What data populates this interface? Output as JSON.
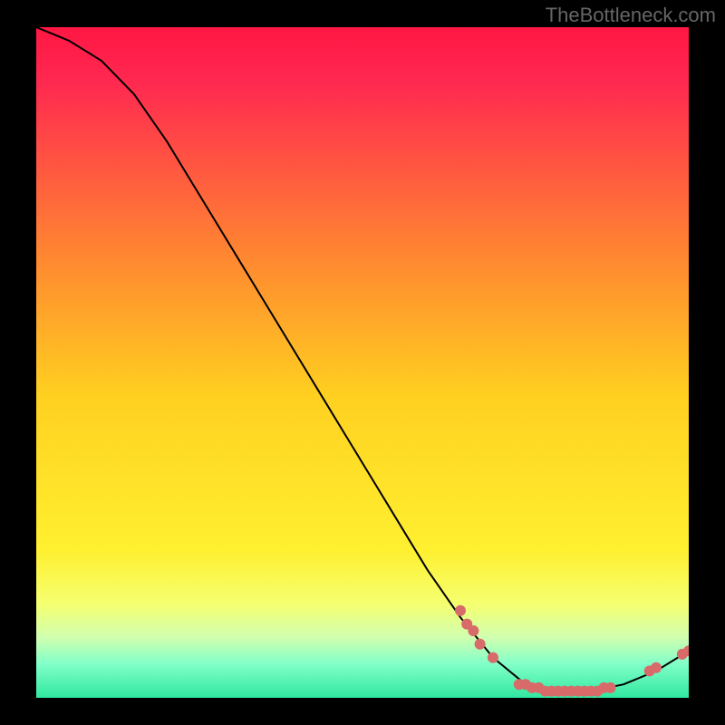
{
  "watermark": "TheBottleneck.com",
  "chart_data": {
    "type": "line",
    "title": "",
    "xlabel": "",
    "ylabel": "",
    "xlim": [
      0,
      100
    ],
    "ylim": [
      0,
      100
    ],
    "curve": [
      {
        "x": 0,
        "y": 100
      },
      {
        "x": 5,
        "y": 98
      },
      {
        "x": 10,
        "y": 95
      },
      {
        "x": 15,
        "y": 90
      },
      {
        "x": 20,
        "y": 83
      },
      {
        "x": 25,
        "y": 75
      },
      {
        "x": 30,
        "y": 67
      },
      {
        "x": 35,
        "y": 59
      },
      {
        "x": 40,
        "y": 51
      },
      {
        "x": 45,
        "y": 43
      },
      {
        "x": 50,
        "y": 35
      },
      {
        "x": 55,
        "y": 27
      },
      {
        "x": 60,
        "y": 19
      },
      {
        "x": 65,
        "y": 12
      },
      {
        "x": 70,
        "y": 6
      },
      {
        "x": 75,
        "y": 2
      },
      {
        "x": 80,
        "y": 1
      },
      {
        "x": 85,
        "y": 1
      },
      {
        "x": 90,
        "y": 2
      },
      {
        "x": 95,
        "y": 4
      },
      {
        "x": 100,
        "y": 7
      }
    ],
    "points": [
      {
        "x": 65,
        "y": 13
      },
      {
        "x": 66,
        "y": 11
      },
      {
        "x": 67,
        "y": 10
      },
      {
        "x": 68,
        "y": 8
      },
      {
        "x": 70,
        "y": 6
      },
      {
        "x": 74,
        "y": 2
      },
      {
        "x": 75,
        "y": 2
      },
      {
        "x": 76,
        "y": 1.5
      },
      {
        "x": 77,
        "y": 1.5
      },
      {
        "x": 78,
        "y": 1
      },
      {
        "x": 79,
        "y": 1
      },
      {
        "x": 80,
        "y": 1
      },
      {
        "x": 81,
        "y": 1
      },
      {
        "x": 82,
        "y": 1
      },
      {
        "x": 83,
        "y": 1
      },
      {
        "x": 84,
        "y": 1
      },
      {
        "x": 85,
        "y": 1
      },
      {
        "x": 86,
        "y": 1
      },
      {
        "x": 87,
        "y": 1.5
      },
      {
        "x": 88,
        "y": 1.5
      },
      {
        "x": 94,
        "y": 4
      },
      {
        "x": 95,
        "y": 4.5
      },
      {
        "x": 99,
        "y": 6.5
      },
      {
        "x": 100,
        "y": 7
      }
    ],
    "gradient_stops": [
      {
        "offset": 0,
        "color": "#ff1744"
      },
      {
        "offset": 0.08,
        "color": "#ff2850"
      },
      {
        "offset": 0.35,
        "color": "#ff8a30"
      },
      {
        "offset": 0.55,
        "color": "#ffd020"
      },
      {
        "offset": 0.78,
        "color": "#fff030"
      },
      {
        "offset": 0.86,
        "color": "#f5ff70"
      },
      {
        "offset": 0.91,
        "color": "#d0ffb0"
      },
      {
        "offset": 0.95,
        "color": "#80ffc8"
      },
      {
        "offset": 1.0,
        "color": "#30e8a0"
      }
    ],
    "point_color": "#d86a6a",
    "curve_color": "#000000"
  }
}
